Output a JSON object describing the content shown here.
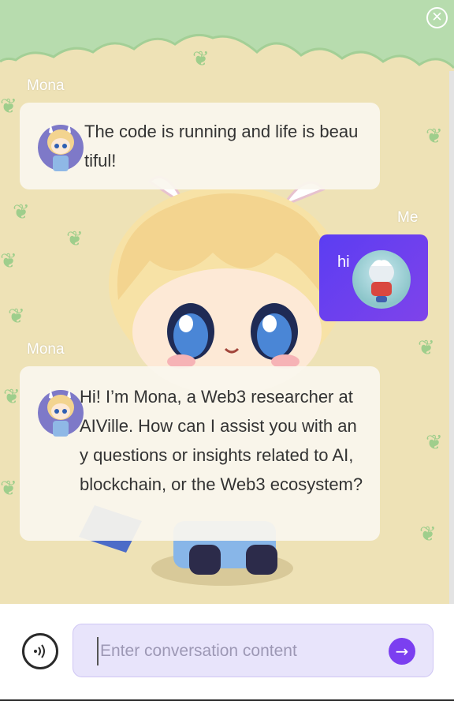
{
  "window": {
    "close_icon": "close-icon"
  },
  "messages": [
    {
      "sender": "Mona",
      "role": "assistant",
      "text": "The code is running and life is beautiful!",
      "avatar": "mona-avatar"
    },
    {
      "sender": "Me",
      "role": "user",
      "text": "hi",
      "avatar": "user-avatar"
    },
    {
      "sender": "Mona",
      "role": "assistant",
      "text": "Hi! I’m Mona, a Web3 researcher at AIVille. How can I assist you with any questions or insights related to AI, blockchain, or the Web3 ecosystem?",
      "avatar": "mona-avatar"
    }
  ],
  "composer": {
    "placeholder": "Enter conversation content",
    "voice_icon": "voice-icon",
    "send_icon": "arrow-right-icon"
  },
  "colors": {
    "background": "#eee2b6",
    "canopy": "#b7dcae",
    "user_bubble": "#6a3ff0",
    "input_bg": "#e8e4fb",
    "send_button": "#7b3ff0"
  }
}
